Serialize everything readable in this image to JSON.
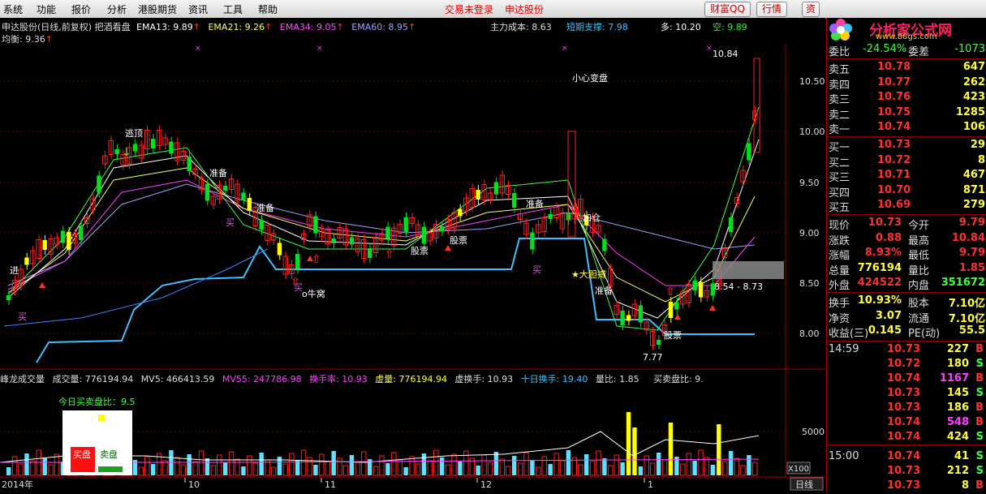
{
  "menu": {
    "items": [
      "系统",
      "功能",
      "报价",
      "分析",
      "港股期货",
      "资讯",
      "工具",
      "帮助"
    ],
    "notice": "交易未登录",
    "stock_link": "申达股份",
    "buttons": [
      "财富QQ",
      "行情",
      "资"
    ]
  },
  "header": {
    "stock": "申达股份(日线,前复权)",
    "indicator": "把酒看盘",
    "ema13": "EMA13: 9.89",
    "ema21": "EMA21: 9.26",
    "ema34": "EMA34: 9.05",
    "ema60": "EMA60: 8.95",
    "main_cost": "主力成本: 8.63",
    "short_support": "短期支撑: 7.98",
    "duo": "多: 10.20",
    "kong": "空: 9.89",
    "balance": "均衡: 9.36"
  },
  "chart_annotations": {
    "high_label": "10.84",
    "low_label": "7.77",
    "range_label": "8.54 - 8.73",
    "xiaoxin": "小心变盘",
    "taoding": "逃顶",
    "zhunbei": "准备",
    "mai": "买",
    "gupiao": "股票",
    "niuwo": "o牛窝",
    "dadan": "★大胆搏",
    "jiacang": "加仓",
    "jin": "进",
    "price_axis": [
      "10.50",
      "10.00",
      "9.50",
      "9.00",
      "8.50",
      "8.00"
    ]
  },
  "volume": {
    "title": "峰龙成交量",
    "vol": "成交量: 776194.94",
    "mv5": "MV5: 466413.59",
    "mv55": "MV55: 247786.98",
    "turnover": "换手率: 10.93",
    "xuliang": "虚量: 776194.94",
    "xuhuanshou": "虚换手: 10.93",
    "shiri": "十日换手: 19.40",
    "liangbi": "量比: 1.85",
    "maimai": "买卖盘比: 9.",
    "today_ratio": "今日买卖盘比：9.5",
    "buy_label": "买盘",
    "sell_label": "卖盘",
    "vol_axis": "5000",
    "unit": "X100"
  },
  "xaxis": {
    "labels": [
      "2014年",
      "10",
      "11",
      "12",
      "1"
    ],
    "tab": "日线"
  },
  "colors": {
    "up": "#ff2020",
    "down": "#00e020",
    "yellow": "#ffff00",
    "cyan": "#40c0ff",
    "magenta": "#ff40ff"
  },
  "quote": {
    "logo": "分析家公式网",
    "logo_url": "www.88gs.com",
    "weibi": {
      "label": "委比",
      "value": "-24.54%",
      "diff_label": "委差",
      "diff": "-1073"
    },
    "asks": [
      {
        "label": "卖五",
        "price": "10.78",
        "vol": "647"
      },
      {
        "label": "卖四",
        "price": "10.77",
        "vol": "262"
      },
      {
        "label": "卖三",
        "price": "10.76",
        "vol": "423"
      },
      {
        "label": "卖二",
        "price": "10.75",
        "vol": "1285"
      },
      {
        "label": "卖一",
        "price": "10.74",
        "vol": "106"
      }
    ],
    "bids": [
      {
        "label": "买一",
        "price": "10.73",
        "vol": "29"
      },
      {
        "label": "买二",
        "price": "10.72",
        "vol": "8"
      },
      {
        "label": "买三",
        "price": "10.71",
        "vol": "467"
      },
      {
        "label": "买四",
        "price": "10.70",
        "vol": "871"
      },
      {
        "label": "买五",
        "price": "10.69",
        "vol": "279"
      }
    ],
    "stats": [
      {
        "l1": "现价",
        "v1": "10.73",
        "l2": "今开",
        "v2": "9.79"
      },
      {
        "l1": "涨跌",
        "v1": "0.88",
        "l2": "最高",
        "v2": "10.84"
      },
      {
        "l1": "涨幅",
        "v1": "8.93%",
        "l2": "最低",
        "v2": "9.79"
      },
      {
        "l1": "总量",
        "v1": "776194",
        "l2": "量比",
        "v2": "1.85"
      },
      {
        "l1": "外盘",
        "v1": "424522",
        "l2": "内盘",
        "v2": "351672"
      }
    ],
    "stats2": [
      {
        "l1": "换手",
        "v1": "10.93%",
        "l2": "股本",
        "v2": "7.10亿"
      },
      {
        "l1": "净资",
        "v1": "3.07",
        "l2": "流通",
        "v2": "7.10亿"
      },
      {
        "l1": "收益(三)",
        "v1": "0.145",
        "l2": "PE(动)",
        "v2": "55.5"
      }
    ],
    "ticks": [
      {
        "time": "14:59",
        "price": "10.73",
        "vol": "227",
        "bs": "B"
      },
      {
        "time": "",
        "price": "10.72",
        "vol": "180",
        "bs": "S"
      },
      {
        "time": "",
        "price": "10.74",
        "vol": "1167",
        "bs": "B"
      },
      {
        "time": "",
        "price": "10.73",
        "vol": "145",
        "bs": "S"
      },
      {
        "time": "",
        "price": "10.73",
        "vol": "186",
        "bs": "B"
      },
      {
        "time": "",
        "price": "10.74",
        "vol": "548",
        "bs": "B"
      },
      {
        "time": "",
        "price": "10.74",
        "vol": "424",
        "bs": "S"
      },
      {
        "time": "15:00",
        "price": "10.74",
        "vol": "41",
        "bs": "S"
      },
      {
        "time": "",
        "price": "10.73",
        "vol": "212",
        "bs": "S"
      },
      {
        "time": "",
        "price": "10.73",
        "vol": "8",
        "bs": "B"
      }
    ]
  }
}
